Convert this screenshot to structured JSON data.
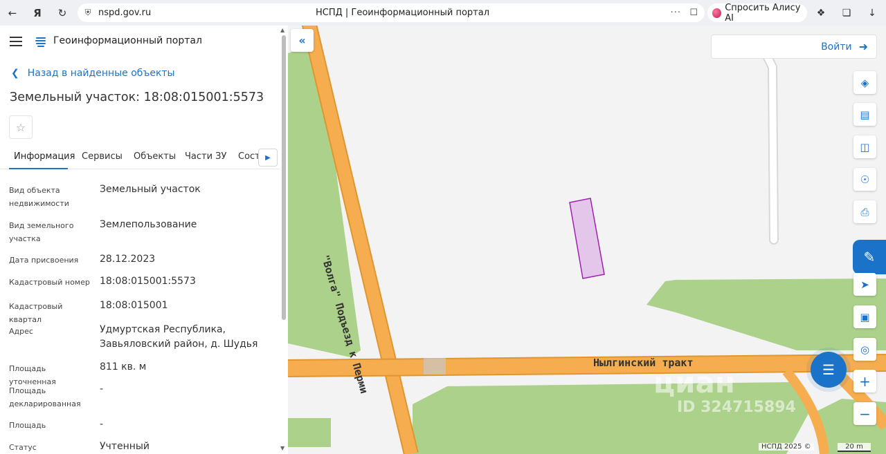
{
  "browser": {
    "url": "nspd.gov.ru",
    "page_title": "НСПД | Геоинформационный портал",
    "alice_label": "Спросить Алису AI"
  },
  "app": {
    "title": "Геоинформационный портал"
  },
  "panel": {
    "back_label": "Назад в найденные объекты",
    "object_title": "Земельный участок: 18:08:015001:5573",
    "tabs": [
      {
        "label": "Информация"
      },
      {
        "label": "Сервисы"
      },
      {
        "label": "Объекты"
      },
      {
        "label": "Части ЗУ"
      },
      {
        "label": "Соста"
      }
    ],
    "rows": [
      {
        "label": "Вид объекта недвижимости",
        "value": "Земельный участок"
      },
      {
        "label": "Вид земельного участка",
        "value": "Землепользование"
      },
      {
        "label": "Дата присвоения",
        "value": "28.12.2023"
      },
      {
        "label": "Кадастровый номер",
        "value": "18:08:015001:5573"
      },
      {
        "label": "Кадастровый квартал",
        "value": "18:08:015001"
      },
      {
        "label": "Адрес",
        "value": "Удмуртская Республика, Завьяловский район, д. Шудья"
      },
      {
        "label": "Площадь уточненная",
        "value": "811 кв. м"
      },
      {
        "label": "Площадь декларированная",
        "value": "-"
      },
      {
        "label": "Площадь",
        "value": "-"
      },
      {
        "label": "Статус",
        "value": "Учтенный"
      }
    ]
  },
  "map": {
    "login_label": "Войти",
    "road_volga": "\"Волга\" Подъезд к Перми",
    "road_nylga": "Нылгинский тракт",
    "watermark": "циан",
    "watermark_id": "ID 324715894",
    "attribution": "НСПД 2025 ©",
    "scale": "20 m",
    "colors": {
      "road": "#f5ad4f",
      "green": "#acd18b",
      "parcel_fill": "#e3c6ea",
      "parcel_stroke": "#a020b0",
      "accent": "#1a73c8"
    }
  }
}
